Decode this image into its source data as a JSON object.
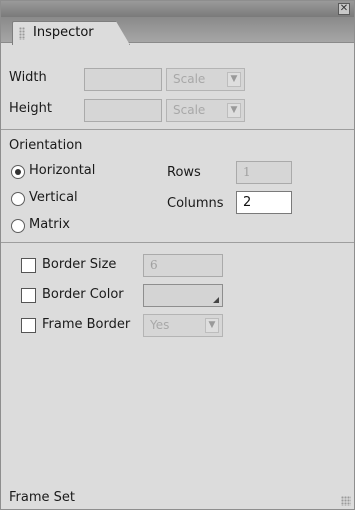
{
  "window": {
    "close_glyph": "✕"
  },
  "tab": {
    "label": "Inspector"
  },
  "size": {
    "width_label": "Width",
    "height_label": "Height",
    "width_value": "",
    "height_value": "",
    "width_unit": "Scale",
    "height_unit": "Scale"
  },
  "orientation": {
    "heading": "Orientation",
    "options": [
      "Horizontal",
      "Vertical",
      "Matrix"
    ],
    "selected": "Horizontal",
    "rows_label": "Rows",
    "rows_value": "1",
    "columns_label": "Columns",
    "columns_value": "2"
  },
  "border": {
    "border_size_label": "Border Size",
    "border_size_value": "6",
    "border_color_label": "Border Color",
    "frame_border_label": "Frame Border",
    "frame_border_value": "Yes"
  },
  "status": {
    "text": "Frame Set"
  }
}
